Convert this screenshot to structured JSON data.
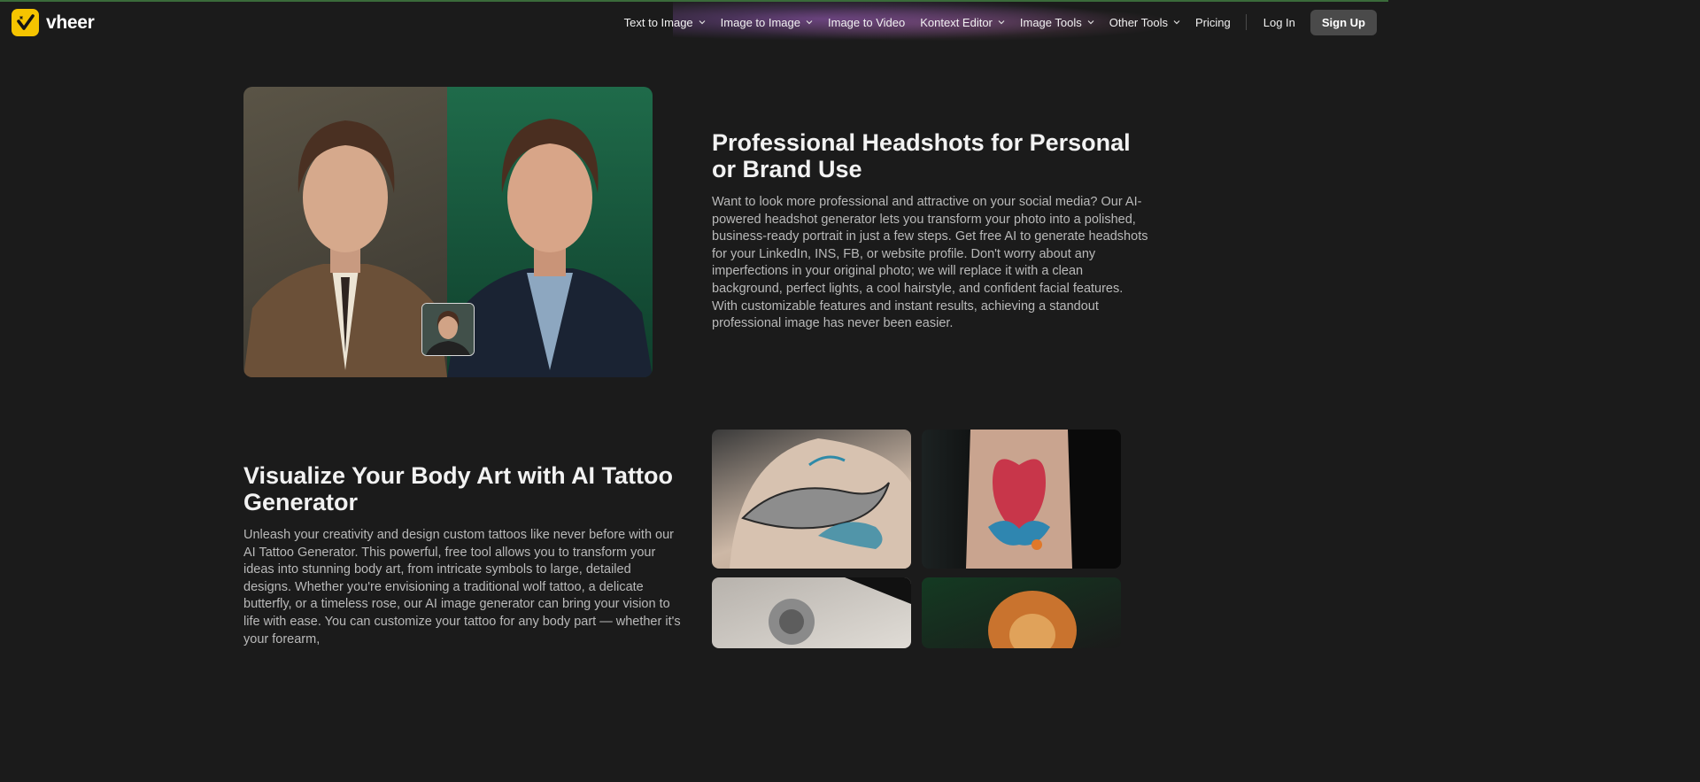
{
  "brand": {
    "name": "vheer",
    "accent": "#f5c400"
  },
  "nav": {
    "items": [
      {
        "label": "Text to Image",
        "dropdown": true
      },
      {
        "label": "Image to Image",
        "dropdown": true
      },
      {
        "label": "Image to Video",
        "dropdown": false
      },
      {
        "label": "Kontext Editor",
        "dropdown": true
      },
      {
        "label": "Image Tools",
        "dropdown": true
      },
      {
        "label": "Other Tools",
        "dropdown": true
      },
      {
        "label": "Pricing",
        "dropdown": false
      }
    ],
    "login": "Log In",
    "signup": "Sign Up"
  },
  "sections": [
    {
      "title": "Professional Headshots for Personal or Brand Use",
      "body": "Want to look more professional and attractive on your social media? Our AI-powered headshot generator lets you transform your photo into a polished, business-ready portrait in just a few steps. Get free AI to generate headshots for your LinkedIn, INS, FB, or website profile. Don't worry about any imperfections in your original photo; we will replace it with a clean background, perfect lights, a cool hairstyle, and confident facial features. With customizable features and instant results, achieving a standout professional image has never been easier."
    },
    {
      "title": "Visualize Your Body Art with AI Tattoo Generator",
      "body": "Unleash your creativity and design custom tattoos like never before with our AI Tattoo Generator. This powerful, free tool allows you to transform your ideas into stunning body art, from intricate symbols to large, detailed designs. Whether you're envisioning a traditional wolf tattoo, a delicate butterfly, or a timeless rose, our AI image generator can bring your vision to life with ease. You can customize your tattoo for any body part — whether it's your forearm,"
    }
  ]
}
